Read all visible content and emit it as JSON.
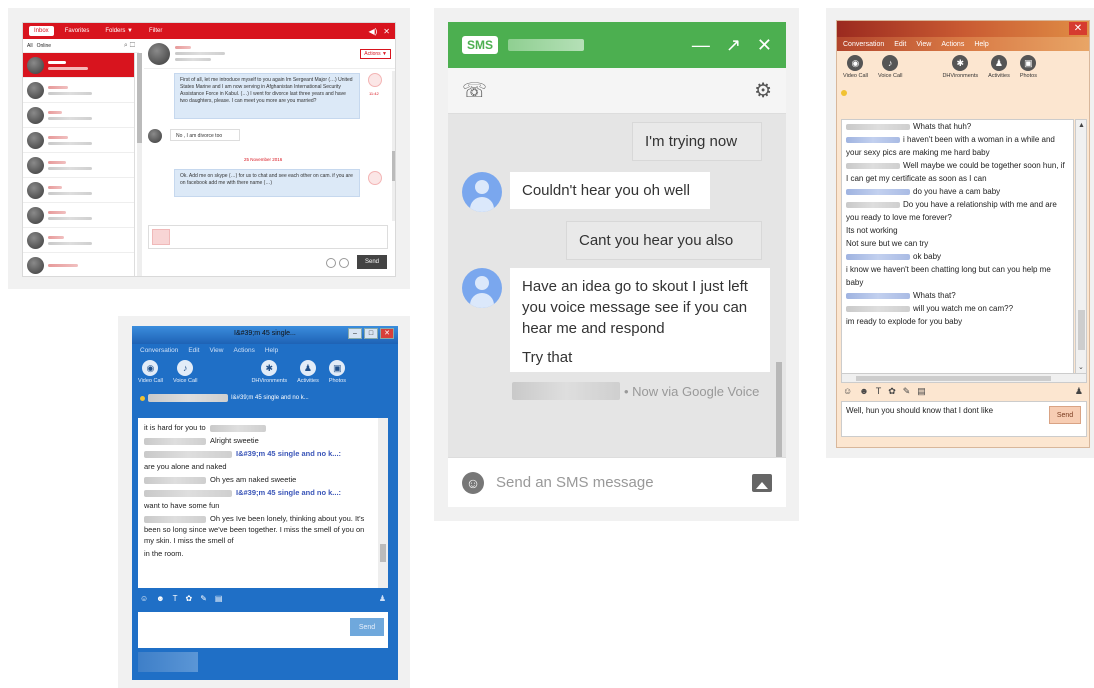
{
  "panel1": {
    "tabs": [
      "Inbox",
      "Favorites",
      "Folders ▼",
      "Filter"
    ],
    "filter": {
      "all": "All",
      "online": "Online"
    },
    "actions_label": "Actions ▼",
    "messages": [
      "First of all, let me introduce myself to you again Im Sergeant Major (…) United States Marine and I am now serving in Afghanistan International Security Assistance Force in Kabul. (…) I went for divorce last three years and have two daughters, please. I can meet you more are you married?",
      "No , I am divorce too",
      "Ok. Add me on skype (…) for us to chat and see each other on cam. if you are on facebook add me with there name (…)"
    ],
    "date_divider": "25 November 2016",
    "send_label": "Send"
  },
  "panel2": {
    "badge": "SMS",
    "messages": [
      {
        "dir": "out",
        "text": "I'm trying now"
      },
      {
        "dir": "in",
        "text": "Couldn't hear you oh well"
      },
      {
        "dir": "out",
        "text": "Cant you hear you also"
      },
      {
        "dir": "in",
        "text": "Have an idea go to skout I just left you voice message see if you can hear me and respond"
      },
      {
        "dir": "in",
        "text": "Try that"
      }
    ],
    "meta": "• Now via Google Voice",
    "placeholder": "Send an SMS message"
  },
  "panel3": {
    "menu": [
      "Conversation",
      "Edit",
      "View",
      "Actions",
      "Help"
    ],
    "tools": [
      "Video Call",
      "Voice Call",
      "DHVironments",
      "Activities",
      "Photos"
    ],
    "lines": [
      {
        "nick": true,
        "text": "Whats that huh?"
      },
      {
        "nick": true,
        "text": "i haven't been with a woman in a while and your sexy pics are making me hard baby"
      },
      {
        "nick": true,
        "text": "Well maybe we could be together soon hun, if I can get my certificate as soon as I can"
      },
      {
        "nick": true,
        "text": "do you have a cam baby"
      },
      {
        "nick": true,
        "text": "Do you have a relationship with me and are you ready to love me forever?"
      },
      {
        "nick": false,
        "text": "Its not working"
      },
      {
        "nick": false,
        "text": "Not sure but we can try"
      },
      {
        "nick": true,
        "text": "ok baby"
      },
      {
        "nick": false,
        "text": "i know we haven't been chatting long but can you help me baby"
      },
      {
        "nick": true,
        "text": "Whats that?"
      },
      {
        "nick": true,
        "text": "will you watch me on cam??"
      },
      {
        "nick": false,
        "text": "im ready  to explode for you baby"
      }
    ],
    "input_text": "Well, hun you should know that I dont like",
    "send_label": "Send"
  },
  "panel4": {
    "title": "I&#39;m 45 single...",
    "menu": [
      "Conversation",
      "Edit",
      "View",
      "Actions",
      "Help"
    ],
    "tools": [
      "Video Call",
      "Voice Call",
      "DHVironments",
      "Activities",
      "Photos"
    ],
    "status_name": "I&#39;m 45 single and no k...",
    "lines": [
      {
        "kind": "text",
        "text": "it is hard for you to"
      },
      {
        "kind": "reply",
        "text": "Alright sweetie"
      },
      {
        "kind": "nick",
        "text": "I&#39;m 45 single and no k...:"
      },
      {
        "kind": "text",
        "text": "are you alone and naked"
      },
      {
        "kind": "reply",
        "text": "Oh yes am naked sweetie"
      },
      {
        "kind": "nick",
        "text": "I&#39;m 45 single and no k...:"
      },
      {
        "kind": "text",
        "text": "want to have some fun"
      },
      {
        "kind": "reply",
        "text": "Oh yes Ive been lonely, thinking about you. It's been so long since we've been together. I miss the smell of you on my skin. I miss the smell of"
      },
      {
        "kind": "text",
        "text": "in the room."
      }
    ],
    "send_label": "Send"
  }
}
